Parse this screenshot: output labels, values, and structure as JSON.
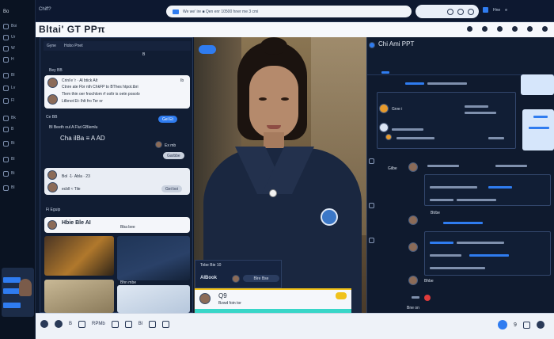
{
  "topbar": {
    "app_name": "Chiff?",
    "url_text": "We we' ire ■ Qen enr 10500 hner me 3 cmi",
    "right_text": "Hne",
    "badge": "e"
  },
  "titlebar": {
    "title": "Bltai' GT PPπ"
  },
  "rail": {
    "title": "Bo",
    "items": [
      "Boi",
      "Ur",
      "W",
      "H",
      "Bl",
      "Lv",
      "Fl",
      "Bk",
      "B",
      "Bi",
      "Bl",
      "Bi",
      "Bl",
      "Bi",
      "El",
      "E1",
      "Gi",
      "Le",
      "Bl"
    ]
  },
  "chatpanel": {
    "header_tabs": [
      "Gyne",
      "Hobo Pnet"
    ],
    "header_right": "B",
    "section1": "Bey BB",
    "card1": {
      "line1": "Crini'e 'r · Al btick Alt",
      "line2": "Ctnre ate Fbr nth ChkFP to BThes htpot.tbri",
      "line3": "Tlem thin oer fnochlom rf ooltr is oetn posolo",
      "line4": "Ltlbnot Et- lhlt fro Ter or",
      "badge": "Ib"
    },
    "section2": "Ce BB",
    "pill_blue_1": "Gel Et",
    "status_line": "Bl Beeth oul A Flut GBlemlu",
    "ai_label": "Cha ilBa ≡ A AD",
    "ai_right": "Ex mb",
    "pill_grey_1": "Garbbe",
    "card2": {
      "line1": "Bol ·1· Abla · 23",
      "line2": "ecbll ≈ Tile",
      "pill": "Gei boi"
    },
    "section3": "Fi Eguip",
    "card3": {
      "title": "Hbie Ble AI",
      "right": "Bba bee"
    },
    "section4": "Bhn mbe",
    "thumb_label_1": "Bhn mbe",
    "thumb_label_2": "Bpn Bte"
  },
  "portrait": {
    "aibook_top": "Tobe Bie 10",
    "aibook_title": "AIBook",
    "aibook_sub": "Blre Bse",
    "green_card_title": "Q9",
    "green_card_sub": "Bzwd foin tor"
  },
  "rightpanel": {
    "title": "Chi Ami PPT",
    "rows": [
      "Grve i",
      "Gilbe",
      "Gbe",
      "Bbb",
      "Gbe"
    ],
    "labels": [
      "Btrbe",
      "Bhbe"
    ],
    "bottom": "Bne on"
  },
  "taskbar": {
    "items": [
      "B",
      "Te",
      "E",
      "RPMb",
      "Bl",
      "Bl"
    ],
    "right_text": "9"
  }
}
